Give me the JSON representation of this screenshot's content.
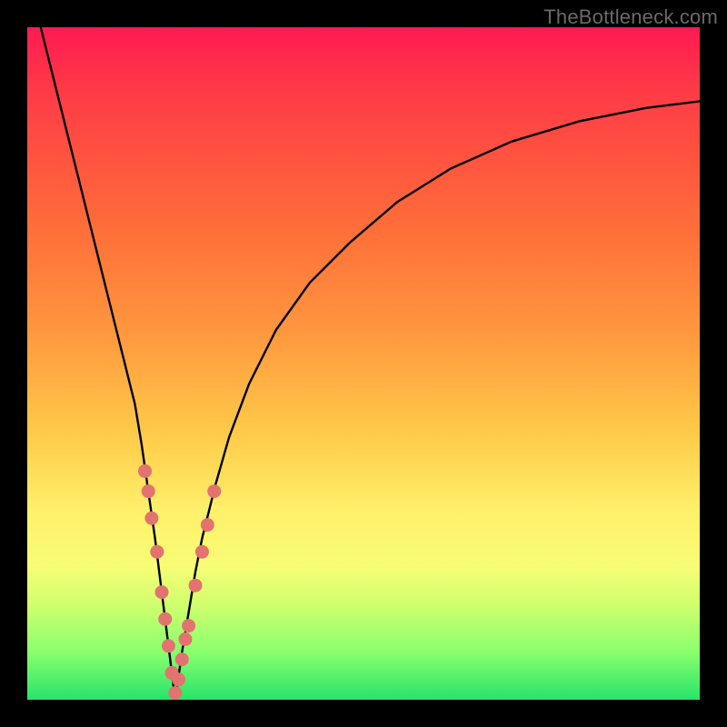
{
  "watermark": "TheBottleneck.com",
  "colors": {
    "frame": "#000000",
    "curve": "#000000",
    "dots": "#e2736f",
    "gradient_stops": [
      "#ff1a52",
      "#ff3c46",
      "#ff6e39",
      "#ff963e",
      "#ffc948",
      "#fff06b",
      "#f8fd75",
      "#cfff6e",
      "#88ff6e",
      "#27e36b"
    ]
  },
  "chart_data": {
    "type": "line",
    "title": "",
    "xlabel": "",
    "ylabel": "",
    "xlim": [
      0,
      100
    ],
    "ylim": [
      0,
      100
    ],
    "x_optimum": 22,
    "series": [
      {
        "name": "bottleneck-curve",
        "x": [
          2,
          5,
          8,
          10,
          12,
          14,
          16,
          17,
          18,
          19,
          20,
          21,
          22,
          23,
          24,
          25,
          26,
          28,
          30,
          33,
          37,
          42,
          48,
          55,
          63,
          72,
          82,
          92,
          100
        ],
        "values": [
          100,
          88,
          76,
          68,
          60,
          52,
          44,
          38,
          31,
          24,
          16,
          8,
          0,
          7,
          13,
          19,
          24,
          32,
          39,
          47,
          55,
          62,
          68,
          74,
          79,
          83,
          86,
          88,
          89
        ]
      }
    ],
    "dots": {
      "name": "highlighted-range",
      "x": [
        17.5,
        18,
        18.5,
        19.3,
        20,
        20.5,
        21,
        21.5,
        22,
        22.5,
        23,
        23.5,
        24,
        25,
        26,
        26.8,
        27.8
      ],
      "values": [
        34,
        31,
        27,
        22,
        16,
        12,
        8,
        4,
        1,
        3,
        6,
        9,
        11,
        17,
        22,
        26,
        31
      ]
    }
  }
}
